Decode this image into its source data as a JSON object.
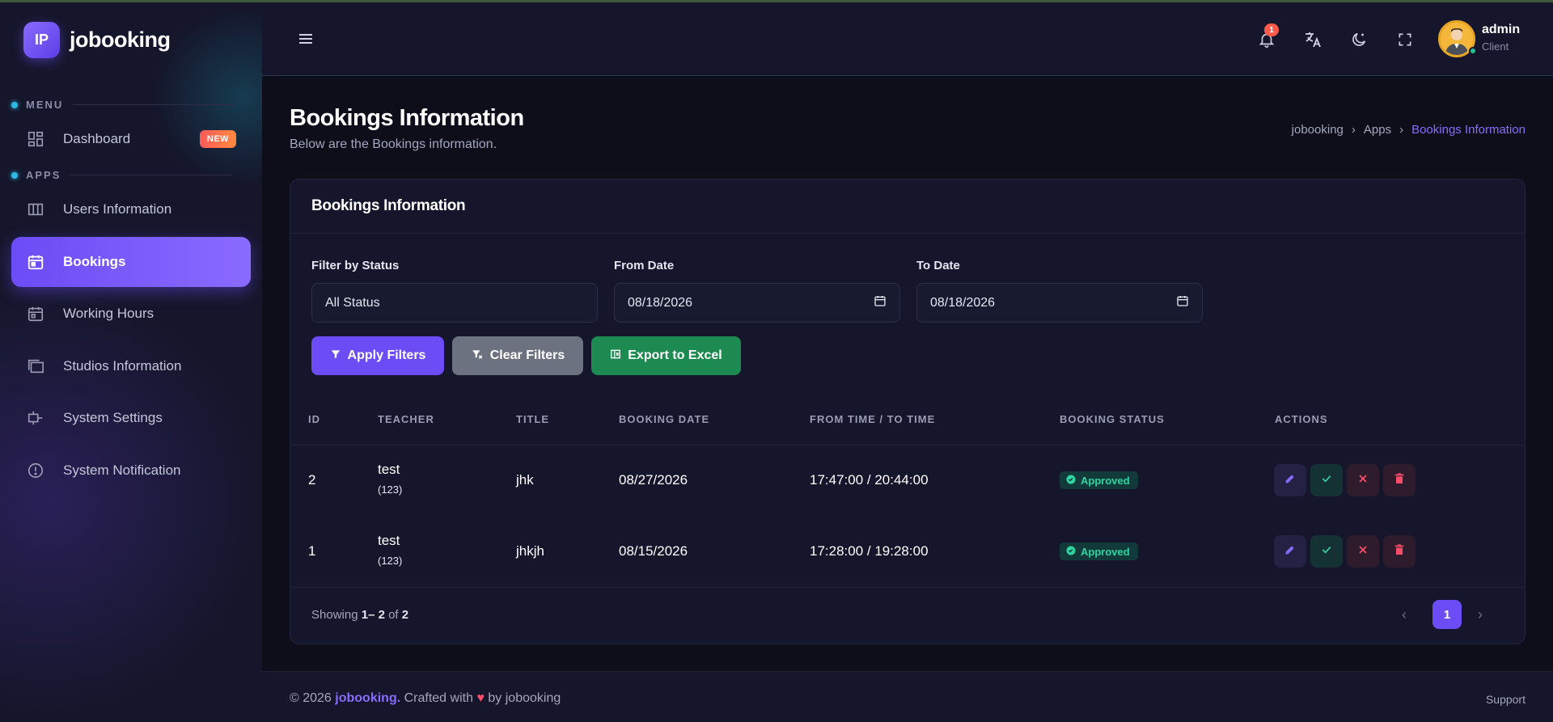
{
  "brand": {
    "logo_text": "IP",
    "name": "jobooking"
  },
  "sidebar": {
    "sections": [
      {
        "title": "MENU"
      },
      {
        "title": "APPS"
      }
    ],
    "items": [
      {
        "label": "Dashboard",
        "icon": "dashboard-icon",
        "badge": "NEW"
      },
      {
        "label": "Users Information",
        "icon": "table-icon"
      },
      {
        "label": "Bookings",
        "icon": "calendar-icon",
        "active": true
      },
      {
        "label": "Working Hours",
        "icon": "calendar-icon"
      },
      {
        "label": "Studios Information",
        "icon": "folders-icon"
      },
      {
        "label": "System Settings",
        "icon": "settings-icon"
      },
      {
        "label": "System Notification",
        "icon": "alert-circle-icon"
      }
    ]
  },
  "header": {
    "notification_count": "1",
    "user": {
      "name": "admin",
      "role": "Client"
    }
  },
  "page": {
    "title": "Bookings Information",
    "subtitle": "Below are the Bookings information.",
    "breadcrumb": [
      "jobooking",
      "Apps",
      "Bookings Information"
    ],
    "breadcrumb_sep": "›"
  },
  "card": {
    "title": "Bookings Information",
    "filters": {
      "status_label": "Filter by Status",
      "status_value": "All Status",
      "from_label": "From Date",
      "from_value": "08/18/2026",
      "to_label": "To Date",
      "to_value": "08/18/2026"
    },
    "buttons": {
      "apply": "Apply Filters",
      "clear": "Clear Filters",
      "export": "Export to Excel"
    },
    "table": {
      "columns": [
        "ID",
        "TEACHER",
        "TITLE",
        "BOOKING DATE",
        "FROM TIME / TO TIME",
        "BOOKING STATUS",
        "ACTIONS"
      ],
      "rows": [
        {
          "id": "2",
          "teacher": "test",
          "teacher_sub": "(123)",
          "title": "jhk",
          "date": "08/27/2026",
          "time": "17:47:00 / 20:44:00",
          "status": "Approved"
        },
        {
          "id": "1",
          "teacher": "test",
          "teacher_sub": "(123)",
          "title": "jhkjh",
          "date": "08/15/2026",
          "time": "17:28:00 / 19:28:00",
          "status": "Approved"
        }
      ]
    },
    "pagination": {
      "showing_prefix": "Showing",
      "range_start": "1",
      "range_end": "– 2",
      "of": "of",
      "total": "2",
      "current_page": "1",
      "prev": "‹",
      "next": "›"
    }
  },
  "footer": {
    "year": "© 2026",
    "brand": "jobooking.",
    "crafted": "Crafted with",
    "heart": "♥",
    "by": "by jobooking",
    "support": "Support"
  },
  "colors": {
    "accent": "#6c4cf5",
    "success": "#2fd6a2",
    "danger": "#ff4d6a",
    "sidebar_bg": "#15162b",
    "page_bg": "#0d0e1a"
  }
}
